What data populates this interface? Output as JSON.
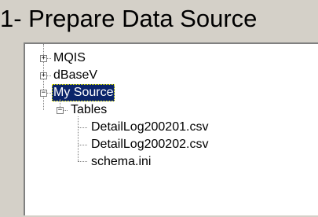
{
  "title": "1- Prepare Data Source",
  "tree": {
    "nodes": [
      {
        "label": "MQIS",
        "expanded": false
      },
      {
        "label": "dBaseV",
        "expanded": false
      },
      {
        "label": "My Source",
        "expanded": true,
        "selected": true
      },
      {
        "label": "Tables",
        "expanded": true
      },
      {
        "label": "DetailLog200201.csv"
      },
      {
        "label": "DetailLog200202.csv"
      },
      {
        "label": "schema.ini"
      }
    ],
    "expand_glyph": "+",
    "collapse_glyph": "−"
  },
  "colors": {
    "background": "#d4d0c8",
    "tree_background": "#ffffff",
    "selection": "#0a246a"
  }
}
